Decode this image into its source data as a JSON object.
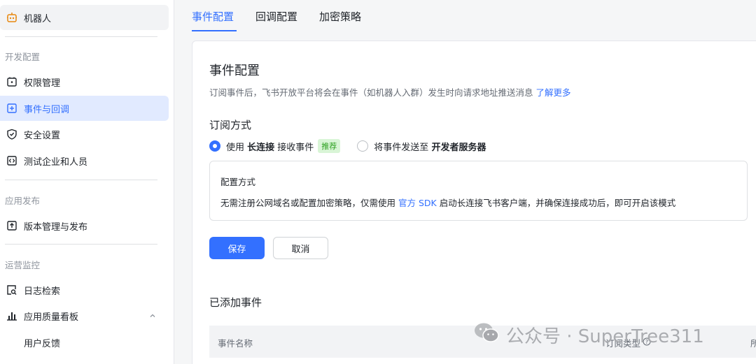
{
  "sidebar": {
    "app_name": "机器人",
    "sections": [
      {
        "label": "开发配置",
        "items": [
          {
            "label": "权限管理",
            "icon": "lock-icon"
          },
          {
            "label": "事件与回调",
            "icon": "event-icon",
            "active": true
          },
          {
            "label": "安全设置",
            "icon": "shield-icon"
          },
          {
            "label": "测试企业和人员",
            "icon": "code-icon"
          }
        ]
      },
      {
        "label": "应用发布",
        "items": [
          {
            "label": "版本管理与发布",
            "icon": "upload-icon"
          }
        ]
      },
      {
        "label": "运营监控",
        "items": [
          {
            "label": "日志检索",
            "icon": "log-search-icon"
          },
          {
            "label": "应用质量看板",
            "icon": "bar-chart-icon"
          },
          {
            "label": "用户反馈"
          }
        ]
      }
    ]
  },
  "tabs": [
    {
      "label": "事件配置",
      "active": true
    },
    {
      "label": "回调配置"
    },
    {
      "label": "加密策略"
    }
  ],
  "main": {
    "title": "事件配置",
    "description": "订阅事件后，飞书开放平台将会在事件（如机器人入群）发生时向请求地址推送消息",
    "learn_more": "了解更多",
    "subscription_title": "订阅方式",
    "option1": {
      "prefix": "使用 ",
      "bold": "长连接",
      "suffix": " 接收事件",
      "badge": "推荐"
    },
    "option2": {
      "prefix": "将事件发送至 ",
      "bold": "开发者服务器"
    },
    "config_title": "配置方式",
    "config_text_before": "无需注册公网域名或配置加密策略，仅需使用 ",
    "config_link": "官方 SDK",
    "config_text_after": " 启动长连接飞书客户端，并确保连接成功后，即可开启该模式",
    "save": "保存",
    "cancel": "取消",
    "added_events_title": "已添加事件",
    "table_headers": [
      "事件名称",
      "订阅类型",
      "所"
    ]
  },
  "watermark": "公众号 · SuperTree311",
  "colors": {
    "accent": "#3370ff",
    "badge_bg": "#d9f5d6",
    "badge_text": "#2ea121"
  }
}
